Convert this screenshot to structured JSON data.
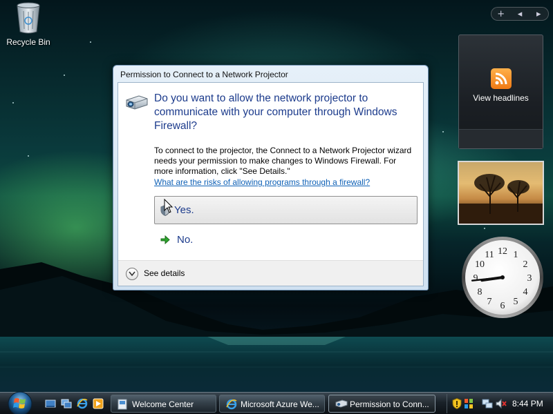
{
  "desktop": {
    "recycle_bin_label": "Recycle Bin"
  },
  "sidebar": {
    "controls": {
      "add": "+",
      "prev": "◂",
      "next": "▸"
    },
    "feed_gadget": {
      "label": "View headlines",
      "icon": "rss-icon",
      "accent": "#f08a1e"
    },
    "clock": {
      "hour_numbers": [
        "12",
        "1",
        "2",
        "3",
        "4",
        "5",
        "6",
        "7",
        "8",
        "9",
        "10",
        "11"
      ],
      "hour": 8,
      "minute": 44
    }
  },
  "dialog": {
    "title": "Permission to Connect to a Network Projector",
    "main_instruction": "Do you want to allow the network projector to communicate with your computer through Windows Firewall?",
    "body": "To connect to the projector, the Connect to a Network Projector wizard needs your permission to make changes to Windows Firewall. For more information, click \"See Details.\"",
    "link": "What are the risks of allowing programs through a firewall?",
    "yes_label": "Yes.",
    "no_label": "No.",
    "details_label": "See details",
    "accent": "#1c3b8c",
    "link_color": "#0f61b6"
  },
  "taskbar": {
    "quick_launch": [
      "show-desktop-icon",
      "switch-windows-icon",
      "internet-explorer-icon",
      "media-player-icon"
    ],
    "tasks": [
      {
        "label": "Welcome Center",
        "icon": "welcome-center-icon",
        "active": false
      },
      {
        "label": "Microsoft Azure We...",
        "icon": "internet-explorer-icon",
        "active": false
      },
      {
        "label": "Permission to Conn...",
        "icon": "projector-icon",
        "active": true
      }
    ],
    "clock": "8:44 PM"
  }
}
